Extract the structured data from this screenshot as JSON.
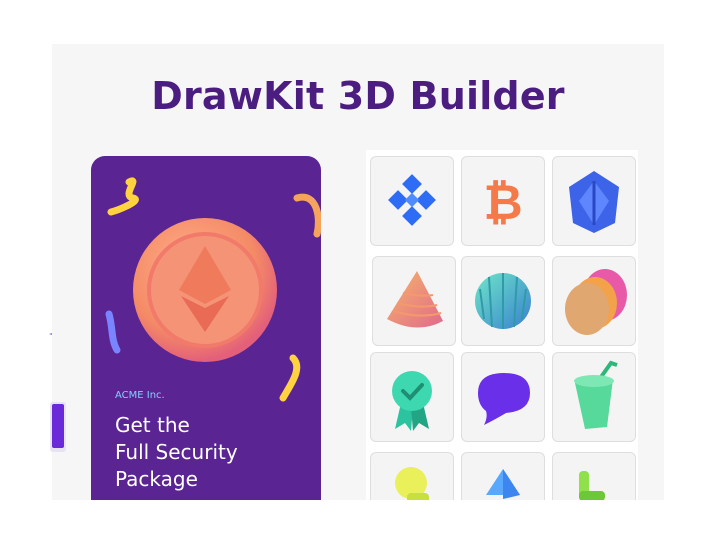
{
  "page": {
    "title": "DrawKit 3D Builder"
  },
  "promo_card": {
    "company": "ACME Inc.",
    "headline_lines": [
      "Get the",
      "Full Security",
      "Package"
    ]
  },
  "icon_grid": {
    "tiles": [
      {
        "icon": "binance-coin-icon"
      },
      {
        "icon": "bitcoin-icon"
      },
      {
        "icon": "polygon-gem-icon"
      },
      {
        "icon": "ribbed-cone-icon"
      },
      {
        "icon": "ribbed-sphere-icon"
      },
      {
        "icon": "stacked-discs-icon"
      },
      {
        "icon": "award-badge-icon"
      },
      {
        "icon": "chat-bubble-icon"
      },
      {
        "icon": "drink-cup-icon"
      },
      {
        "icon": "yellow-shape-icon"
      },
      {
        "icon": "blue-pyramid-icon"
      },
      {
        "icon": "green-shape-icon"
      }
    ]
  },
  "colors": {
    "title": "#4c1d80",
    "promo_bg": "#5a2592",
    "company_text": "#7fd0ff",
    "frame_bg": "#f6f6f7"
  }
}
